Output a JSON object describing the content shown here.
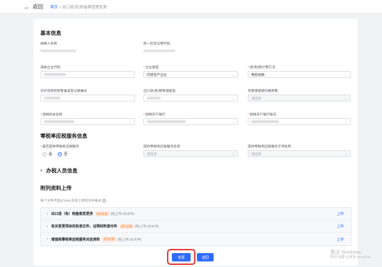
{
  "topbar": {
    "back_label": "返回",
    "crumb_home": "首页",
    "crumb_sep": " > ",
    "crumb_current": "出口退(免)税备案管理变更"
  },
  "basic": {
    "title": "基本信息",
    "taxpayer_name_label": "纳税人名称",
    "credit_code_label": "统一社会信用代码",
    "customs_code_label": "海关企业代码",
    "enterprise_type_label": "企业类型",
    "enterprise_type_value": "内资生产企业",
    "refund_method_label": "退(免)税计算方法",
    "refund_method_value": "免抵退税",
    "foreign_trade_label": "对外贸易经营者备案登记表编号",
    "mgmt_type_label": "出口退(免)税管理类型",
    "mgmt_type_placeholder": "请选择",
    "policy_label": "享受增值税优惠政策",
    "policy_placeholder": "请选择",
    "tax_office_label": "退税机关名称",
    "bank_label": "退税开户银行",
    "account_label": "退税开户银行账号"
  },
  "zero_rate": {
    "title": "零税率应税服务信息",
    "provide_label": "是否提供零税率应税服务",
    "no_label": "是",
    "yes_label": "否",
    "service_name_label": "提供零税率应税服务名称",
    "service_name_placeholder": "请选择",
    "service_sub_label": "提供零税率应税服务子项名称",
    "service_sub_placeholder": "请选择"
  },
  "staff": {
    "title": "办税人员信息"
  },
  "attachments": {
    "title": "附列资料上传",
    "hint": "单个文件不超过10M,支持上传的文件格式",
    "rows": [
      {
        "name": "出口退（免）税备案变更表",
        "tag": "条件必报",
        "limit": "(限上传1份文件)",
        "upload": "上传"
      },
      {
        "name": "有关变更项目的批准文件、证明材料复印件",
        "tag": "条件必报",
        "limit": "(限上传1份文件)",
        "upload": "上传"
      },
      {
        "name": "增值税零税率应税服务对应资料",
        "tag": "条件必报",
        "limit": "(限上传1份文件)",
        "upload": "上传"
      }
    ]
  },
  "buttons": {
    "change": "变更",
    "back": "返回"
  },
  "watermark": {
    "line1": "激活 Windows",
    "line2": "转到\"设置\"以激活 Windows。"
  },
  "colors": {
    "accent": "#2f6bff",
    "highlight": "#e53935",
    "tag_bg": "#fde7d9",
    "tag_fg": "#f07a2c"
  }
}
